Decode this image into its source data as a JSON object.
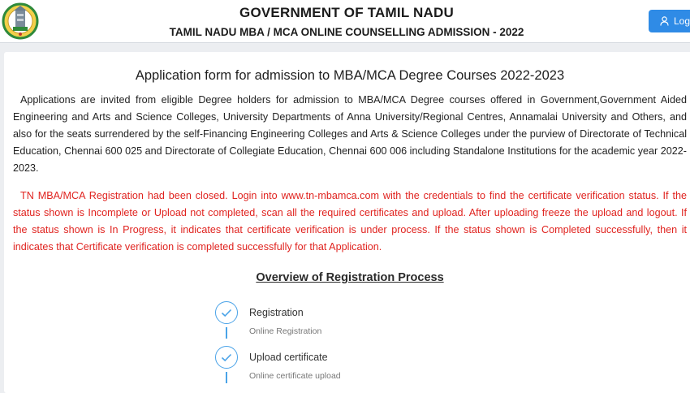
{
  "header": {
    "gov_title": "GOVERNMENT OF TAMIL NADU",
    "subtitle": "TAMIL NADU MBA / MCA ONLINE COUNSELLING ADMISSION - 2022",
    "login_label": "Login"
  },
  "main": {
    "form_title": "Application form for admission to MBA/MCA Degree Courses 2022-2023",
    "intro_text": "Applications are invited from eligible Degree holders for admission to MBA/MCA Degree courses offered in Government,Government Aided Engineering and Arts and Science Colleges, University Departments of Anna University/Regional Centres, Annamalai University and Others, and also for the seats surrendered by the self-Financing Engineering Colleges and Arts & Science Colleges under the purview of Directorate of Technical Education, Chennai 600 025 and Directorate of Collegiate Education, Chennai 600 006 including Standalone Institutions for the academic year 2022- 2023.",
    "notice_text": "TN MBA/MCA Registration had been closed. Login into www.tn-mbamca.com with the credentials to find the certificate verification status. If the status shown is Incomplete or Upload not completed, scan all the required certificates and upload. After uploading freeze the upload and logout. If the status shown is In Progress, it indicates that certificate verification is under process. If the status shown is Completed successfully, then it indicates that Certificate verification is completed successfully for that Application.",
    "overview_title": "Overview of Registration Process",
    "steps": [
      {
        "title": "Registration",
        "subtitle": "Online Registration"
      },
      {
        "title": "Upload certificate",
        "subtitle": "Online certificate upload"
      }
    ]
  },
  "colors": {
    "accent": "#2f8be6",
    "notice": "#e0231f",
    "step": "#4aa3e8"
  },
  "icons": {
    "logo": "tamil-nadu-emblem",
    "login": "user-icon",
    "step": "check-icon"
  }
}
